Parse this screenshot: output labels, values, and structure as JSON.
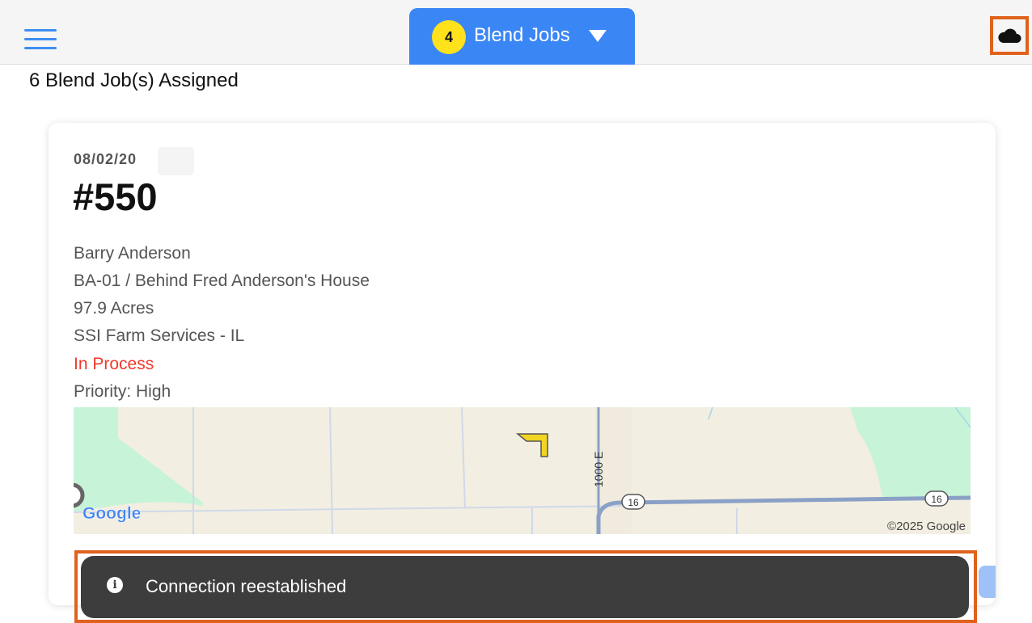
{
  "header": {
    "menu_icon": "hamburger-menu-icon",
    "jobs_count": "4",
    "jobs_label": "Blend Jobs",
    "jobs_caret_icon": "caret-down-icon",
    "sync_icon": "cloud-icon"
  },
  "assigned_text": "6 Blend Job(s) Assigned",
  "card": {
    "date": "08/02/20",
    "number": "#550",
    "customer": "Barry Anderson",
    "field": "BA-01 / Behind Fred Anderson's House",
    "acres": "97.9 Acres",
    "location": "SSI Farm Services - IL",
    "status": "In Process",
    "priority": "Priority: High"
  },
  "map": {
    "road_label": "1000 E",
    "route_shield_1": "16",
    "route_shield_2": "16",
    "google_logo": "Google",
    "copyright": "©2025 Google",
    "colors": {
      "land": "#f3eee2",
      "park": "#c7f3d8",
      "road": "#8aa0c6",
      "field": "#f2d522"
    }
  },
  "toast": {
    "icon": "info-icon",
    "message": "Connection reestablished"
  },
  "colors": {
    "accent": "#3b86f5",
    "badge": "#ffe21c",
    "status_red": "#f0382b",
    "highlight": "#e0621c"
  }
}
